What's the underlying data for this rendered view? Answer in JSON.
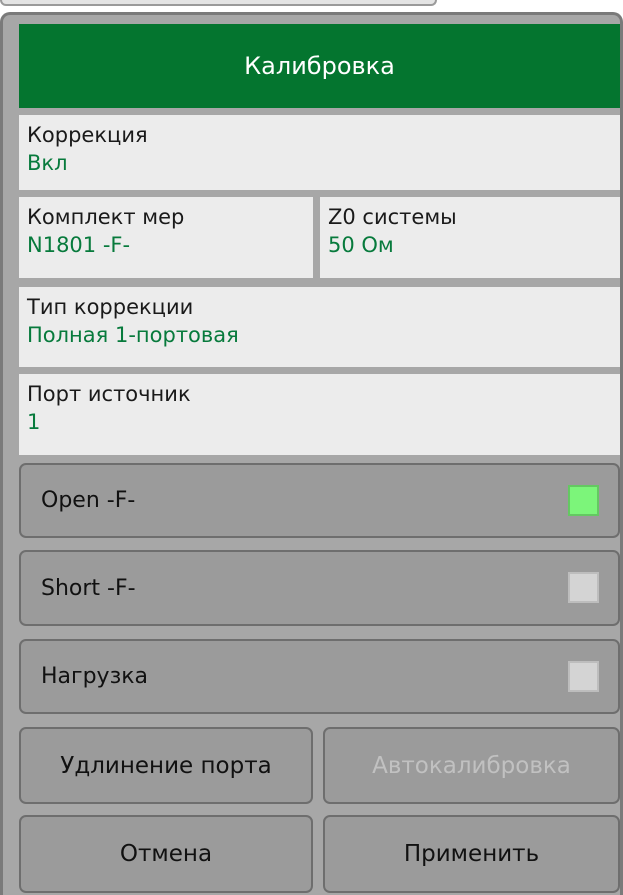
{
  "header": {
    "title": "Калибровка"
  },
  "fields": {
    "correction": {
      "label": "Коррекция",
      "value": "Вкл"
    },
    "cal_kit": {
      "label": "Комплект мер",
      "value": "N1801 -F-"
    },
    "z0": {
      "label": "Z0 системы",
      "value": "50 Ом"
    },
    "correction_type": {
      "label": "Тип коррекции",
      "value": "Полная 1-портовая"
    },
    "source_port": {
      "label": "Порт источник",
      "value": "1"
    }
  },
  "standards": [
    {
      "label": "Open -F-",
      "measured": true,
      "indicator_color": "#7cf57a"
    },
    {
      "label": "Short -F-",
      "measured": false,
      "indicator_color": "#d4d4d4"
    },
    {
      "label": "Нагрузка",
      "measured": false,
      "indicator_color": "#d4d4d4"
    }
  ],
  "buttons": {
    "port_extension": "Удлинение порта",
    "autocal": "Автокалибровка",
    "cancel": "Отмена",
    "apply": "Применить"
  },
  "colors": {
    "header_bg": "#04752f",
    "value_text": "#077a3c",
    "panel_bg": "#a7a7a7"
  }
}
